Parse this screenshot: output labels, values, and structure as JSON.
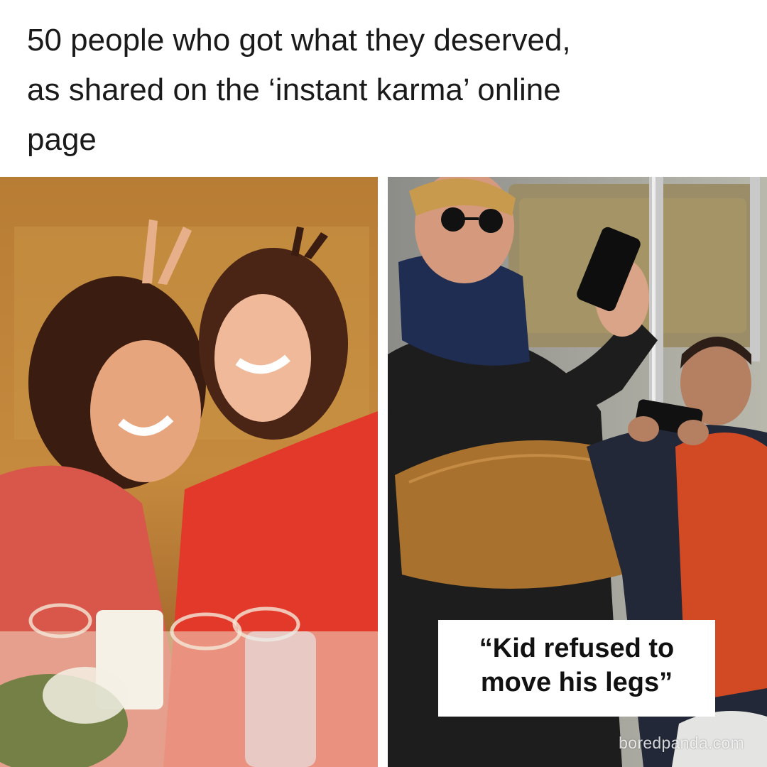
{
  "headline": {
    "line1": "50 people who got what they deserved,",
    "line2": "as shared on the ‘instant karma’ online",
    "line3": "page"
  },
  "photos": [
    {
      "id": "left",
      "subject": "two-women-bunny-ears-photo"
    },
    {
      "id": "right",
      "subject": "subway-selfie-photo"
    }
  ],
  "caption": {
    "line1": "“Kid refused to",
    "line2": "move his legs”"
  },
  "watermark": {
    "text": "boredpanda.com"
  },
  "colors": {
    "background": "#ffffff",
    "headline_text": "#1a1a1a",
    "caption_background": "#ffffff",
    "caption_text": "#111111"
  }
}
